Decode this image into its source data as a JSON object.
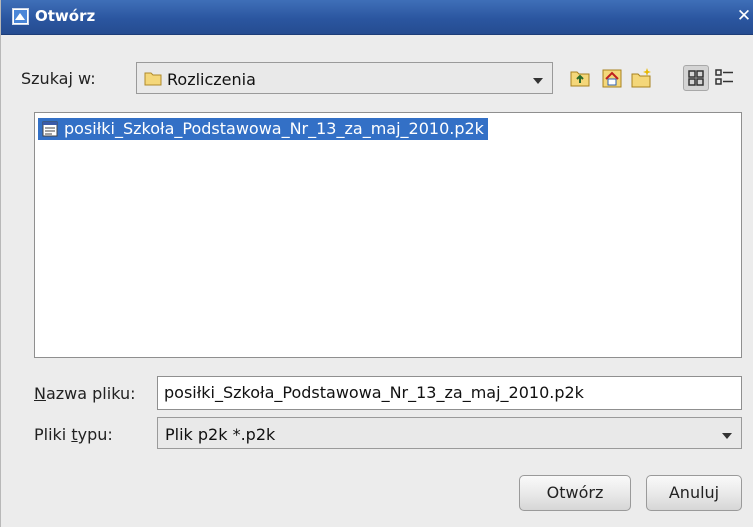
{
  "window": {
    "title": "Otwórz"
  },
  "lookin": {
    "label": "Szukaj w:",
    "value": "Rozliczenia"
  },
  "toolbar": {
    "buttons": [
      "up-folder-icon",
      "home-icon",
      "new-folder-icon",
      "list-view-icon",
      "details-view-icon"
    ]
  },
  "files": [
    {
      "name": "posiłki_Szkoła_Podstawowa_Nr_13_za_maj_2010.p2k",
      "selected": true
    }
  ],
  "filename": {
    "label_mnemonic": "N",
    "label_rest": "azwa pliku:",
    "value": "posiłki_Szkoła_Podstawowa_Nr_13_za_maj_2010.p2k"
  },
  "filetype": {
    "label_pre": "Pliki ",
    "label_mnemonic": "t",
    "label_post": "ypu:",
    "value": "Plik p2k *.p2k"
  },
  "buttons": {
    "open": "Otwórz",
    "cancel": "Anuluj"
  }
}
